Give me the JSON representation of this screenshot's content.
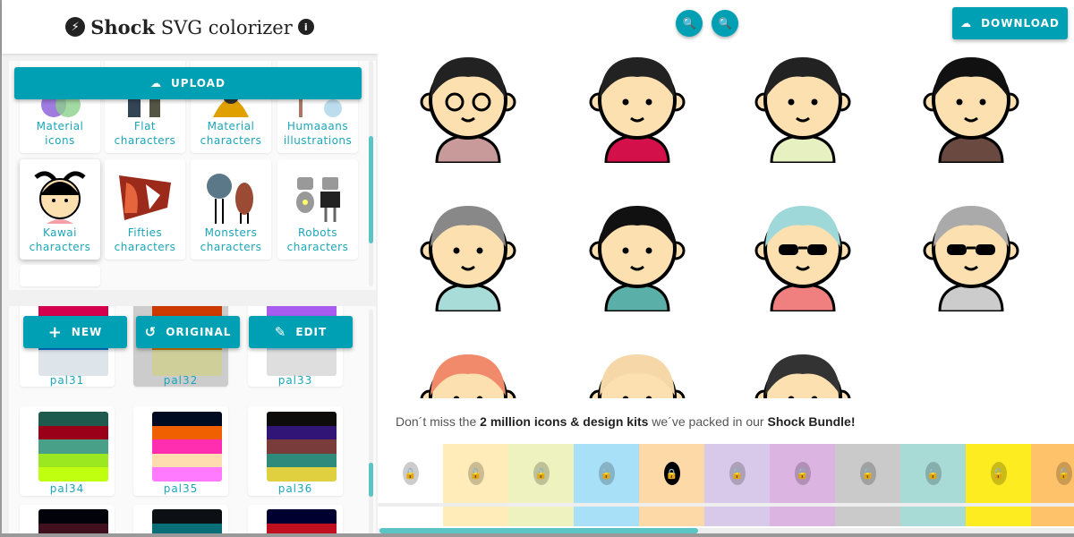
{
  "header": {
    "brand": "Shock",
    "title": "SVG colorizer",
    "logo_icon": "bolt-icon",
    "info_icon": "info-icon"
  },
  "upload": {
    "label": "UPLOAD",
    "icon": "cloud-upload-icon"
  },
  "categories": [
    {
      "label1": "Material",
      "label2": "icons"
    },
    {
      "label1": "Flat",
      "label2": "characters"
    },
    {
      "label1": "Material",
      "label2": "characters"
    },
    {
      "label1": "Humaaans",
      "label2": "illustrations"
    },
    {
      "label1": "Kawai",
      "label2": "characters",
      "selected": true
    },
    {
      "label1": "Fifties",
      "label2": "characters"
    },
    {
      "label1": "Monsters",
      "label2": "characters"
    },
    {
      "label1": "Robots",
      "label2": "characters"
    }
  ],
  "palette_actions": {
    "new": "NEW",
    "original": "ORIGINAL",
    "edit": "EDIT"
  },
  "palettes": [
    {
      "name": "pal31",
      "colors": [
        "#d4004e",
        "#0078d8",
        "#dde4ea"
      ]
    },
    {
      "name": "pal32",
      "colors": [
        "#cc3a00",
        "#cc7a00",
        "#cfcf9a"
      ],
      "selected": true
    },
    {
      "name": "pal33",
      "colors": [
        "#a85cf0",
        "#a8d4ee",
        "#dedede"
      ]
    },
    {
      "name": "pal34",
      "colors": [
        "#1e5a4e",
        "#9a0018",
        "#48a088",
        "#9ce820",
        "#c0ff10"
      ]
    },
    {
      "name": "pal35",
      "colors": [
        "#000a20",
        "#f06000",
        "#ff2eb0",
        "#fedcb0",
        "#ff7aff"
      ]
    },
    {
      "name": "pal36",
      "colors": [
        "#0e0c0a",
        "#301476",
        "#7a3c3a",
        "#2e8a7a",
        "#e0d040"
      ]
    },
    {
      "name": "",
      "colors": [
        "#02020a",
        "#40101e"
      ]
    },
    {
      "name": "",
      "colors": [
        "#0c1014",
        "#0a6e78"
      ]
    },
    {
      "name": "",
      "colors": [
        "#000030",
        "#c01020"
      ]
    }
  ],
  "toolbar": {
    "zoom_out_icon": "zoom-out-icon",
    "zoom_in_icon": "zoom-in-icon",
    "download": "DOWNLOAD",
    "download_icon": "cloud-download-icon"
  },
  "banner": {
    "pre": "Don´t miss the ",
    "bold1": "2 million icons & design kits",
    "mid": " we´ve packed in our ",
    "bold2": "Shock Bundle!"
  },
  "colors": [
    {
      "hex": "#ffffff",
      "locked": false
    },
    {
      "hex": "#ffecb8",
      "locked": false
    },
    {
      "hex": "#eef2bf",
      "locked": false
    },
    {
      "hex": "#a8e0f8",
      "locked": false
    },
    {
      "hex": "#fed9a8",
      "locked": true
    },
    {
      "hex": "#d8c8ea",
      "locked": false
    },
    {
      "hex": "#dcb4e2",
      "locked": false
    },
    {
      "hex": "#cacaca",
      "locked": false
    },
    {
      "hex": "#a8dad6",
      "locked": false
    },
    {
      "hex": "#fdec1f",
      "locked": false
    },
    {
      "hex": "#fec26a",
      "locked": false
    }
  ],
  "accent": "#00a0b4"
}
